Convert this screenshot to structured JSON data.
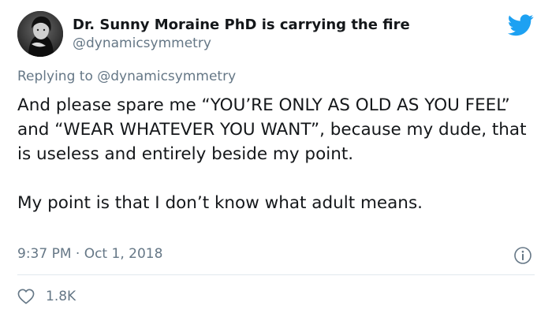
{
  "author": {
    "display_name": "Dr. Sunny Moraine PhD is carrying the fire",
    "handle": "@dynamicsymmetry",
    "avatar_icon": "avatar-portrait",
    "platform_icon": "twitter-bird-icon"
  },
  "reply": {
    "prefix": "Replying to",
    "mention": "@dynamicsymmetry"
  },
  "tweet": {
    "paragraph_1": "And please spare me “YOU’RE ONLY AS OLD AS YOU FEEL” and “WEAR WHATEVER YOU WANT”, because my dude, that is useless and entirely beside my point.",
    "paragraph_2": "My point is that I don’t know what adult means.",
    "timestamp": "9:37 PM · Oct 1, 2018"
  },
  "actions": {
    "like_count": "1.8K",
    "like_icon": "heart-icon",
    "info_icon": "info-icon"
  },
  "colors": {
    "text_primary": "#14171a",
    "text_secondary": "#657786",
    "brand_blue": "#1da1f2",
    "divider": "#e1e8ed"
  }
}
